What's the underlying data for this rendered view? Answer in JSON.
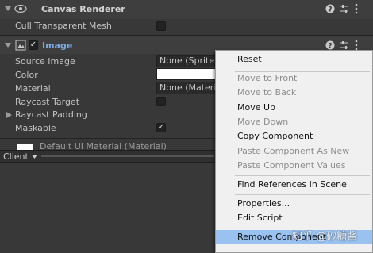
{
  "canvas_renderer": {
    "title": "Canvas Renderer",
    "cull_label": "Cull Transparent Mesh"
  },
  "image_component": {
    "title": "Image",
    "enabled": true,
    "source_image_label": "Source Image",
    "source_image_value": "None (Sprite)",
    "color_label": "Color",
    "color_value": "#ffffff",
    "material_label": "Material",
    "material_value": "None (Material)",
    "raycast_target_label": "Raycast Target",
    "raycast_padding_label": "Raycast Padding",
    "maskable_label": "Maskable",
    "maskable_checked": true
  },
  "material_preview": {
    "label": "Default UI Material (Material)"
  },
  "bottom_bar": {
    "dropdown_label": "Client"
  },
  "context_menu": {
    "items": [
      {
        "label": "Reset",
        "enabled": true
      },
      {
        "label": "Move to Front",
        "enabled": false
      },
      {
        "label": "Move to Back",
        "enabled": false
      },
      {
        "label": "Move Up",
        "enabled": true
      },
      {
        "label": "Move Down",
        "enabled": false
      },
      {
        "label": "Copy Component",
        "enabled": true
      },
      {
        "label": "Paste Component As New",
        "enabled": false
      },
      {
        "label": "Paste Component Values",
        "enabled": false
      },
      {
        "label": "Find References In Scene",
        "enabled": true
      },
      {
        "label": "Properties...",
        "enabled": true
      },
      {
        "label": "Edit Script",
        "enabled": true
      },
      {
        "label": "Remove Component",
        "enabled": true,
        "highlighted": true
      }
    ]
  },
  "watermark": {
    "text": "知乎 @砂糖酱"
  },
  "colors": {
    "title_blue": "#7aa7e0",
    "menu_highlight": "#99c2f0"
  }
}
